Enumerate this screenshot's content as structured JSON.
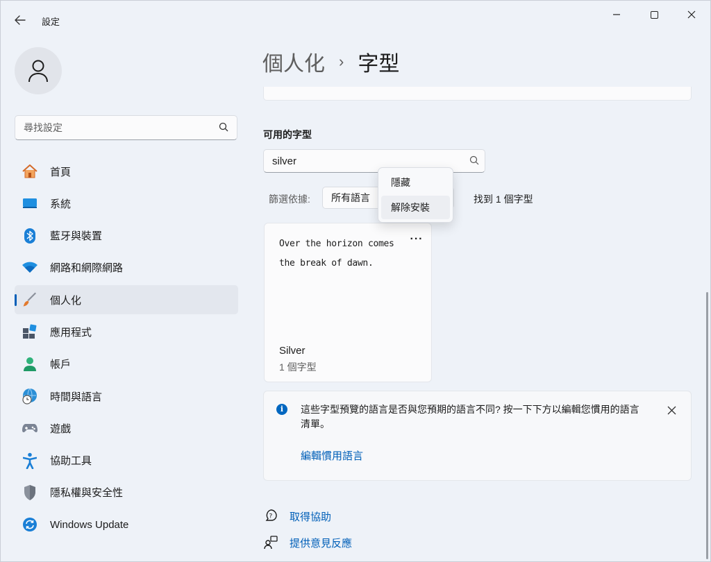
{
  "app": {
    "title": "設定",
    "window_controls": {
      "minimize": "—",
      "maximize": "☐",
      "close": "✕"
    }
  },
  "sidebar": {
    "search_placeholder": "尋找設定",
    "items": [
      {
        "label": "首頁",
        "icon": "home-icon"
      },
      {
        "label": "系統",
        "icon": "system-icon"
      },
      {
        "label": "藍牙與裝置",
        "icon": "bluetooth-icon"
      },
      {
        "label": "網路和網際網路",
        "icon": "wifi-icon"
      },
      {
        "label": "個人化",
        "icon": "brush-icon",
        "active": true
      },
      {
        "label": "應用程式",
        "icon": "apps-icon"
      },
      {
        "label": "帳戶",
        "icon": "account-icon"
      },
      {
        "label": "時間與語言",
        "icon": "time-language-icon"
      },
      {
        "label": "遊戲",
        "icon": "gaming-icon"
      },
      {
        "label": "協助工具",
        "icon": "accessibility-icon"
      },
      {
        "label": "隱私權與安全性",
        "icon": "shield-icon"
      },
      {
        "label": "Windows Update",
        "icon": "update-icon"
      }
    ]
  },
  "main": {
    "breadcrumb": {
      "parent": "個人化",
      "separator": "›",
      "current": "字型"
    },
    "section_title": "可用的字型",
    "font_search": {
      "value": "silver"
    },
    "filter": {
      "label": "篩選依據:",
      "selected": "所有語言"
    },
    "found_text": "找到 1 個字型",
    "context_menu": {
      "items": [
        "隱藏",
        "解除安裝"
      ]
    },
    "font_card": {
      "preview_line1": "Over the horizon comes",
      "preview_line2": "the break of dawn.",
      "more": "···",
      "name": "Silver",
      "count": "1 個字型"
    },
    "info_bar": {
      "message": "這些字型預覽的語言是否與您預期的語言不同? 按一下下方以編輯您慣用的語言清單。",
      "link": "編輯慣用語言"
    },
    "help_links": {
      "get_help": "取得協助",
      "feedback": "提供意見反應"
    }
  },
  "colors": {
    "accent": "#005fb8",
    "background": "#eef2f8",
    "card": "#fbfbfc"
  }
}
